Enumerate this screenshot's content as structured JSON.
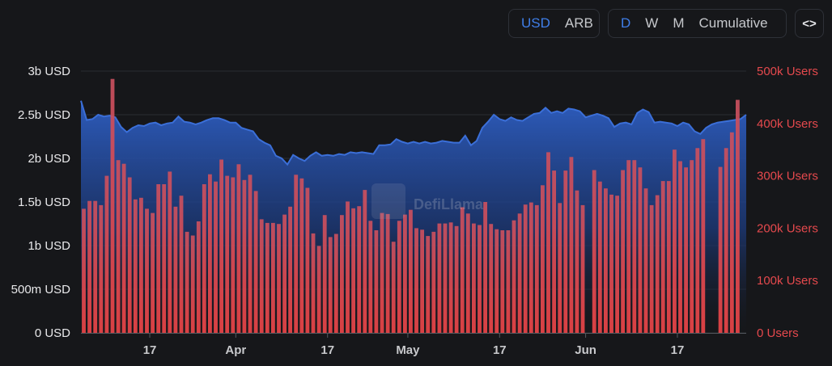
{
  "toolbar": {
    "currency": {
      "options": [
        "USD",
        "ARB"
      ],
      "active": "USD"
    },
    "period": {
      "options": [
        "D",
        "W",
        "M",
        "Cumulative"
      ],
      "active": "D"
    },
    "embed_label": "<>"
  },
  "watermark": "DefiLlama",
  "chart_data": {
    "type": "bar+area",
    "grid": true,
    "legend": "none",
    "y_left": {
      "ticks": [
        "3b USD",
        "2.5b USD",
        "2b USD",
        "1.5b USD",
        "1b USD",
        "500m USD",
        "0 USD"
      ],
      "tick_values": [
        3000000000,
        2500000000,
        2000000000,
        1500000000,
        1000000000,
        500000000,
        0
      ],
      "range": [
        0,
        3000000000
      ],
      "color": "#e8e8ea"
    },
    "y_right": {
      "ticks": [
        "500k Users",
        "400k Users",
        "300k Users",
        "200k Users",
        "100k Users",
        "0 Users"
      ],
      "tick_values": [
        500000,
        400000,
        300000,
        200000,
        100000,
        0
      ],
      "range": [
        0,
        500000
      ],
      "color": "#e5494d"
    },
    "x_axis": {
      "start": "2024-03-05",
      "end": "2024-06-29",
      "ticks": [
        {
          "label": "17",
          "date": "2024-03-17"
        },
        {
          "label": "Apr",
          "date": "2024-04-01"
        },
        {
          "label": "17",
          "date": "2024-04-17"
        },
        {
          "label": "May",
          "date": "2024-05-01"
        },
        {
          "label": "17",
          "date": "2024-05-17"
        },
        {
          "label": "Jun",
          "date": "2024-06-01"
        },
        {
          "label": "17",
          "date": "2024-06-17"
        }
      ]
    },
    "series": [
      {
        "kind": "area",
        "axis": "left",
        "color": "#3b6fd8",
        "points": [
          [
            "2024-03-05",
            2660000000
          ],
          [
            "2024-03-06",
            2440000000
          ],
          [
            "2024-03-07",
            2450000000
          ],
          [
            "2024-03-08",
            2500000000
          ],
          [
            "2024-03-09",
            2480000000
          ],
          [
            "2024-03-10",
            2490000000
          ],
          [
            "2024-03-11",
            2470000000
          ],
          [
            "2024-03-12",
            2360000000
          ],
          [
            "2024-03-13",
            2300000000
          ],
          [
            "2024-03-14",
            2350000000
          ],
          [
            "2024-03-15",
            2380000000
          ],
          [
            "2024-03-16",
            2370000000
          ],
          [
            "2024-03-17",
            2400000000
          ],
          [
            "2024-03-18",
            2410000000
          ],
          [
            "2024-03-19",
            2380000000
          ],
          [
            "2024-03-20",
            2400000000
          ],
          [
            "2024-03-21",
            2410000000
          ],
          [
            "2024-03-22",
            2480000000
          ],
          [
            "2024-03-23",
            2420000000
          ],
          [
            "2024-03-24",
            2410000000
          ],
          [
            "2024-03-25",
            2390000000
          ],
          [
            "2024-03-26",
            2410000000
          ],
          [
            "2024-03-27",
            2440000000
          ],
          [
            "2024-03-28",
            2460000000
          ],
          [
            "2024-03-29",
            2460000000
          ],
          [
            "2024-03-30",
            2440000000
          ],
          [
            "2024-03-31",
            2410000000
          ],
          [
            "2024-04-01",
            2410000000
          ],
          [
            "2024-04-02",
            2350000000
          ],
          [
            "2024-04-03",
            2330000000
          ],
          [
            "2024-04-04",
            2310000000
          ],
          [
            "2024-04-05",
            2220000000
          ],
          [
            "2024-04-06",
            2180000000
          ],
          [
            "2024-04-07",
            2150000000
          ],
          [
            "2024-04-08",
            2030000000
          ],
          [
            "2024-04-09",
            2000000000
          ],
          [
            "2024-04-10",
            1930000000
          ],
          [
            "2024-04-11",
            2040000000
          ],
          [
            "2024-04-12",
            2000000000
          ],
          [
            "2024-04-13",
            1970000000
          ],
          [
            "2024-04-14",
            2030000000
          ],
          [
            "2024-04-15",
            2070000000
          ],
          [
            "2024-04-16",
            2030000000
          ],
          [
            "2024-04-17",
            2040000000
          ],
          [
            "2024-04-18",
            2030000000
          ],
          [
            "2024-04-19",
            2050000000
          ],
          [
            "2024-04-20",
            2040000000
          ],
          [
            "2024-04-21",
            2070000000
          ],
          [
            "2024-04-22",
            2060000000
          ],
          [
            "2024-04-23",
            2070000000
          ],
          [
            "2024-04-24",
            2060000000
          ],
          [
            "2024-04-25",
            2050000000
          ],
          [
            "2024-04-26",
            2150000000
          ],
          [
            "2024-04-27",
            2150000000
          ],
          [
            "2024-04-28",
            2160000000
          ],
          [
            "2024-04-29",
            2220000000
          ],
          [
            "2024-04-30",
            2190000000
          ],
          [
            "2024-05-01",
            2170000000
          ],
          [
            "2024-05-02",
            2190000000
          ],
          [
            "2024-05-03",
            2170000000
          ],
          [
            "2024-05-04",
            2190000000
          ],
          [
            "2024-05-05",
            2170000000
          ],
          [
            "2024-05-06",
            2180000000
          ],
          [
            "2024-05-07",
            2200000000
          ],
          [
            "2024-05-08",
            2190000000
          ],
          [
            "2024-05-09",
            2180000000
          ],
          [
            "2024-05-10",
            2180000000
          ],
          [
            "2024-05-11",
            2260000000
          ],
          [
            "2024-05-12",
            2150000000
          ],
          [
            "2024-05-13",
            2200000000
          ],
          [
            "2024-05-14",
            2350000000
          ],
          [
            "2024-05-15",
            2420000000
          ],
          [
            "2024-05-16",
            2500000000
          ],
          [
            "2024-05-17",
            2450000000
          ],
          [
            "2024-05-18",
            2430000000
          ],
          [
            "2024-05-19",
            2470000000
          ],
          [
            "2024-05-20",
            2440000000
          ],
          [
            "2024-05-21",
            2430000000
          ],
          [
            "2024-05-22",
            2470000000
          ],
          [
            "2024-05-23",
            2510000000
          ],
          [
            "2024-05-24",
            2520000000
          ],
          [
            "2024-05-25",
            2580000000
          ],
          [
            "2024-05-26",
            2520000000
          ],
          [
            "2024-05-27",
            2540000000
          ],
          [
            "2024-05-28",
            2520000000
          ],
          [
            "2024-05-29",
            2570000000
          ],
          [
            "2024-05-30",
            2560000000
          ],
          [
            "2024-05-31",
            2540000000
          ],
          [
            "2024-06-01",
            2470000000
          ],
          [
            "2024-06-02",
            2490000000
          ],
          [
            "2024-06-03",
            2510000000
          ],
          [
            "2024-06-04",
            2490000000
          ],
          [
            "2024-06-05",
            2460000000
          ],
          [
            "2024-06-06",
            2360000000
          ],
          [
            "2024-06-07",
            2400000000
          ],
          [
            "2024-06-08",
            2410000000
          ],
          [
            "2024-06-09",
            2390000000
          ],
          [
            "2024-06-10",
            2520000000
          ],
          [
            "2024-06-11",
            2560000000
          ],
          [
            "2024-06-12",
            2530000000
          ],
          [
            "2024-06-13",
            2410000000
          ],
          [
            "2024-06-14",
            2420000000
          ],
          [
            "2024-06-15",
            2410000000
          ],
          [
            "2024-06-16",
            2400000000
          ],
          [
            "2024-06-17",
            2370000000
          ],
          [
            "2024-06-18",
            2410000000
          ],
          [
            "2024-06-19",
            2390000000
          ],
          [
            "2024-06-20",
            2310000000
          ],
          [
            "2024-06-21",
            2280000000
          ],
          [
            "2024-06-22",
            2350000000
          ],
          [
            "2024-06-23",
            2390000000
          ],
          [
            "2024-06-24",
            2410000000
          ],
          [
            "2024-06-25",
            2420000000
          ],
          [
            "2024-06-26",
            2430000000
          ],
          [
            "2024-06-27",
            2440000000
          ],
          [
            "2024-06-28",
            2450000000
          ],
          [
            "2024-06-29",
            2500000000
          ]
        ]
      },
      {
        "kind": "bar",
        "axis": "right",
        "color": "#e2484c",
        "points": [
          [
            "2024-03-05",
            237000
          ],
          [
            "2024-03-06",
            252000
          ],
          [
            "2024-03-07",
            252000
          ],
          [
            "2024-03-08",
            244000
          ],
          [
            "2024-03-09",
            300000
          ],
          [
            "2024-03-10",
            485000
          ],
          [
            "2024-03-11",
            330000
          ],
          [
            "2024-03-12",
            323000
          ],
          [
            "2024-03-13",
            297000
          ],
          [
            "2024-03-14",
            255000
          ],
          [
            "2024-03-15",
            258000
          ],
          [
            "2024-03-16",
            237000
          ],
          [
            "2024-03-17",
            229000
          ],
          [
            "2024-03-18",
            284000
          ],
          [
            "2024-03-19",
            284000
          ],
          [
            "2024-03-20",
            308000
          ],
          [
            "2024-03-21",
            241000
          ],
          [
            "2024-03-22",
            262000
          ],
          [
            "2024-03-23",
            193000
          ],
          [
            "2024-03-24",
            186000
          ],
          [
            "2024-03-25",
            213000
          ],
          [
            "2024-03-26",
            284000
          ],
          [
            "2024-03-27",
            303000
          ],
          [
            "2024-03-28",
            289000
          ],
          [
            "2024-03-29",
            331000
          ],
          [
            "2024-03-30",
            300000
          ],
          [
            "2024-03-31",
            297000
          ],
          [
            "2024-04-01",
            322000
          ],
          [
            "2024-04-02",
            292000
          ],
          [
            "2024-04-03",
            302000
          ],
          [
            "2024-04-04",
            271000
          ],
          [
            "2024-04-05",
            217000
          ],
          [
            "2024-04-06",
            210000
          ],
          [
            "2024-04-07",
            210000
          ],
          [
            "2024-04-08",
            208000
          ],
          [
            "2024-04-09",
            226000
          ],
          [
            "2024-04-10",
            241000
          ],
          [
            "2024-04-11",
            302000
          ],
          [
            "2024-04-12",
            295000
          ],
          [
            "2024-04-13",
            277000
          ],
          [
            "2024-04-14",
            190000
          ],
          [
            "2024-04-15",
            166000
          ],
          [
            "2024-04-16",
            225000
          ],
          [
            "2024-04-17",
            183000
          ],
          [
            "2024-04-18",
            189000
          ],
          [
            "2024-04-19",
            225000
          ],
          [
            "2024-04-20",
            251000
          ],
          [
            "2024-04-21",
            238000
          ],
          [
            "2024-04-22",
            242000
          ],
          [
            "2024-04-23",
            273000
          ],
          [
            "2024-04-24",
            214000
          ],
          [
            "2024-04-25",
            196000
          ],
          [
            "2024-04-26",
            229000
          ],
          [
            "2024-04-27",
            227000
          ],
          [
            "2024-04-28",
            174000
          ],
          [
            "2024-04-29",
            214000
          ],
          [
            "2024-04-30",
            226000
          ],
          [
            "2024-05-01",
            235000
          ],
          [
            "2024-05-02",
            200000
          ],
          [
            "2024-05-03",
            197000
          ],
          [
            "2024-05-04",
            185000
          ],
          [
            "2024-05-05",
            193000
          ],
          [
            "2024-05-06",
            209000
          ],
          [
            "2024-05-07",
            209000
          ],
          [
            "2024-05-08",
            211000
          ],
          [
            "2024-05-09",
            204000
          ],
          [
            "2024-05-10",
            240000
          ],
          [
            "2024-05-11",
            228000
          ],
          [
            "2024-05-12",
            209000
          ],
          [
            "2024-05-13",
            206000
          ],
          [
            "2024-05-14",
            250000
          ],
          [
            "2024-05-15",
            208000
          ],
          [
            "2024-05-16",
            198000
          ],
          [
            "2024-05-17",
            196000
          ],
          [
            "2024-05-18",
            196000
          ],
          [
            "2024-05-19",
            215000
          ],
          [
            "2024-05-20",
            228000
          ],
          [
            "2024-05-21",
            245000
          ],
          [
            "2024-05-22",
            249000
          ],
          [
            "2024-05-23",
            244000
          ],
          [
            "2024-05-24",
            282000
          ],
          [
            "2024-05-25",
            345000
          ],
          [
            "2024-05-26",
            310000
          ],
          [
            "2024-05-27",
            248000
          ],
          [
            "2024-05-28",
            310000
          ],
          [
            "2024-05-29",
            336000
          ],
          [
            "2024-05-30",
            272000
          ],
          [
            "2024-05-31",
            244000
          ],
          [
            "2024-06-01",
            0
          ],
          [
            "2024-06-02",
            311000
          ],
          [
            "2024-06-03",
            289000
          ],
          [
            "2024-06-04",
            276000
          ],
          [
            "2024-06-05",
            264000
          ],
          [
            "2024-06-06",
            262000
          ],
          [
            "2024-06-07",
            311000
          ],
          [
            "2024-06-08",
            330000
          ],
          [
            "2024-06-09",
            330000
          ],
          [
            "2024-06-10",
            316000
          ],
          [
            "2024-06-11",
            276000
          ],
          [
            "2024-06-12",
            244000
          ],
          [
            "2024-06-13",
            263000
          ],
          [
            "2024-06-14",
            290000
          ],
          [
            "2024-06-15",
            290000
          ],
          [
            "2024-06-16",
            350000
          ],
          [
            "2024-06-17",
            328000
          ],
          [
            "2024-06-18",
            316000
          ],
          [
            "2024-06-19",
            330000
          ],
          [
            "2024-06-20",
            353000
          ],
          [
            "2024-06-21",
            370000
          ],
          [
            "2024-06-22",
            0
          ],
          [
            "2024-06-23",
            0
          ],
          [
            "2024-06-24",
            317000
          ],
          [
            "2024-06-25",
            353000
          ],
          [
            "2024-06-26",
            383000
          ],
          [
            "2024-06-27",
            445000
          ]
        ]
      }
    ]
  }
}
